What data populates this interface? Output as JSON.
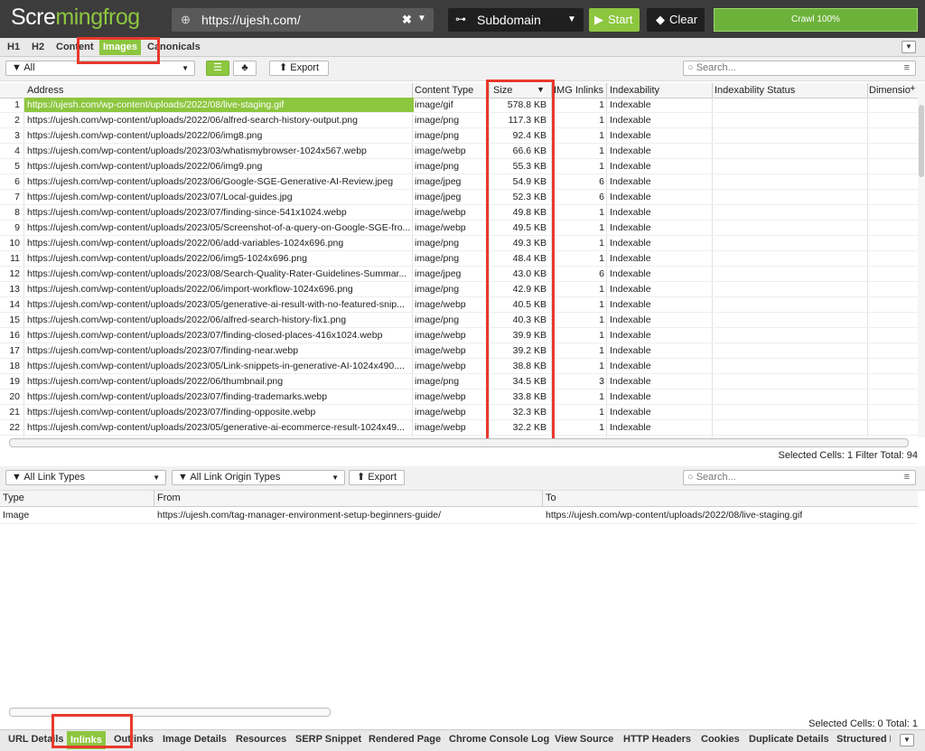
{
  "toolbar": {
    "logo_left": "Scre",
    "logo_frog": "mingfrog",
    "url": "https://ujesh.com/",
    "clear_x": "✖",
    "mode": "Subdomain",
    "start": "Start",
    "clear": "Clear",
    "crawl_status": "Crawl 100%"
  },
  "top_tabs": [
    "H1",
    "H2",
    "Content",
    "Images",
    "Canonicals"
  ],
  "active_top_tab": "Images",
  "filter": {
    "select": "All",
    "export": "Export",
    "search_placeholder": "Search..."
  },
  "table": {
    "columns": [
      "Address",
      "Content Type",
      "Size",
      "IMG Inlinks",
      "Indexability",
      "Indexability Status",
      "Dimensio"
    ],
    "sort_column": "Size",
    "sort_direction": "descending",
    "rows": [
      {
        "n": "1",
        "address": "https://ujesh.com/wp-content/uploads/2022/08/live-staging.gif",
        "type": "image/gif",
        "size": "578.8 KB",
        "inlinks": "1",
        "indexability": "Indexable"
      },
      {
        "n": "2",
        "address": "https://ujesh.com/wp-content/uploads/2022/06/alfred-search-history-output.png",
        "type": "image/png",
        "size": "117.3 KB",
        "inlinks": "1",
        "indexability": "Indexable"
      },
      {
        "n": "3",
        "address": "https://ujesh.com/wp-content/uploads/2022/06/img8.png",
        "type": "image/png",
        "size": "92.4 KB",
        "inlinks": "1",
        "indexability": "Indexable"
      },
      {
        "n": "4",
        "address": "https://ujesh.com/wp-content/uploads/2023/03/whatismybrowser-1024x567.webp",
        "type": "image/webp",
        "size": "66.6 KB",
        "inlinks": "1",
        "indexability": "Indexable"
      },
      {
        "n": "5",
        "address": "https://ujesh.com/wp-content/uploads/2022/06/img9.png",
        "type": "image/png",
        "size": "55.3 KB",
        "inlinks": "1",
        "indexability": "Indexable"
      },
      {
        "n": "6",
        "address": "https://ujesh.com/wp-content/uploads/2023/06/Google-SGE-Generative-AI-Review.jpeg",
        "type": "image/jpeg",
        "size": "54.9 KB",
        "inlinks": "6",
        "indexability": "Indexable"
      },
      {
        "n": "7",
        "address": "https://ujesh.com/wp-content/uploads/2023/07/Local-guides.jpg",
        "type": "image/jpeg",
        "size": "52.3 KB",
        "inlinks": "6",
        "indexability": "Indexable"
      },
      {
        "n": "8",
        "address": "https://ujesh.com/wp-content/uploads/2023/07/finding-since-541x1024.webp",
        "type": "image/webp",
        "size": "49.8 KB",
        "inlinks": "1",
        "indexability": "Indexable"
      },
      {
        "n": "9",
        "address": "https://ujesh.com/wp-content/uploads/2023/05/Screenshot-of-a-query-on-Google-SGE-fro...",
        "type": "image/webp",
        "size": "49.5 KB",
        "inlinks": "1",
        "indexability": "Indexable"
      },
      {
        "n": "10",
        "address": "https://ujesh.com/wp-content/uploads/2022/06/add-variables-1024x696.png",
        "type": "image/png",
        "size": "49.3 KB",
        "inlinks": "1",
        "indexability": "Indexable"
      },
      {
        "n": "11",
        "address": "https://ujesh.com/wp-content/uploads/2022/06/img5-1024x696.png",
        "type": "image/png",
        "size": "48.4 KB",
        "inlinks": "1",
        "indexability": "Indexable"
      },
      {
        "n": "12",
        "address": "https://ujesh.com/wp-content/uploads/2023/08/Search-Quality-Rater-Guidelines-Summar...",
        "type": "image/jpeg",
        "size": "43.0 KB",
        "inlinks": "6",
        "indexability": "Indexable"
      },
      {
        "n": "13",
        "address": "https://ujesh.com/wp-content/uploads/2022/06/import-workflow-1024x696.png",
        "type": "image/png",
        "size": "42.9 KB",
        "inlinks": "1",
        "indexability": "Indexable"
      },
      {
        "n": "14",
        "address": "https://ujesh.com/wp-content/uploads/2023/05/generative-ai-result-with-no-featured-snip...",
        "type": "image/webp",
        "size": "40.5 KB",
        "inlinks": "1",
        "indexability": "Indexable"
      },
      {
        "n": "15",
        "address": "https://ujesh.com/wp-content/uploads/2022/06/alfred-search-history-fix1.png",
        "type": "image/png",
        "size": "40.3 KB",
        "inlinks": "1",
        "indexability": "Indexable"
      },
      {
        "n": "16",
        "address": "https://ujesh.com/wp-content/uploads/2023/07/finding-closed-places-416x1024.webp",
        "type": "image/webp",
        "size": "39.9 KB",
        "inlinks": "1",
        "indexability": "Indexable"
      },
      {
        "n": "17",
        "address": "https://ujesh.com/wp-content/uploads/2023/07/finding-near.webp",
        "type": "image/webp",
        "size": "39.2 KB",
        "inlinks": "1",
        "indexability": "Indexable"
      },
      {
        "n": "18",
        "address": "https://ujesh.com/wp-content/uploads/2023/05/Link-snippets-in-generative-AI-1024x490....",
        "type": "image/webp",
        "size": "38.8 KB",
        "inlinks": "1",
        "indexability": "Indexable"
      },
      {
        "n": "19",
        "address": "https://ujesh.com/wp-content/uploads/2022/06/thumbnail.png",
        "type": "image/png",
        "size": "34.5 KB",
        "inlinks": "3",
        "indexability": "Indexable"
      },
      {
        "n": "20",
        "address": "https://ujesh.com/wp-content/uploads/2023/07/finding-trademarks.webp",
        "type": "image/webp",
        "size": "33.8 KB",
        "inlinks": "1",
        "indexability": "Indexable"
      },
      {
        "n": "21",
        "address": "https://ujesh.com/wp-content/uploads/2023/07/finding-opposite.webp",
        "type": "image/webp",
        "size": "32.3 KB",
        "inlinks": "1",
        "indexability": "Indexable"
      },
      {
        "n": "22",
        "address": "https://ujesh.com/wp-content/uploads/2023/05/generative-ai-ecommerce-result-1024x49...",
        "type": "image/webp",
        "size": "32.2 KB",
        "inlinks": "1",
        "indexability": "Indexable"
      }
    ],
    "status": "Selected Cells: 1  Filter Total:  94"
  },
  "lower": {
    "link_types": "All Link Types",
    "origin_types": "All Link Origin Types",
    "export": "Export",
    "search_placeholder": "Search...",
    "columns": [
      "Type",
      "From",
      "To"
    ],
    "rows": [
      {
        "type": "Image",
        "from": "https://ujesh.com/tag-manager-environment-setup-beginners-guide/",
        "to": "https://ujesh.com/wp-content/uploads/2022/08/live-staging.gif"
      }
    ],
    "status": "Selected Cells: 0  Total:  1"
  },
  "bottom_tabs": [
    "URL Details",
    "Inlinks",
    "Outlinks",
    "Image Details",
    "Resources",
    "SERP Snippet",
    "Rendered Page",
    "Chrome Console Log",
    "View Source",
    "HTTP Headers",
    "Cookies",
    "Duplicate Details",
    "Structured Da"
  ],
  "active_bottom_tab": "Inlinks",
  "colors": {
    "accent_green": "#8dc63f",
    "highlight_red": "#e8392c",
    "toolbar_dark": "#3c3c3c"
  }
}
